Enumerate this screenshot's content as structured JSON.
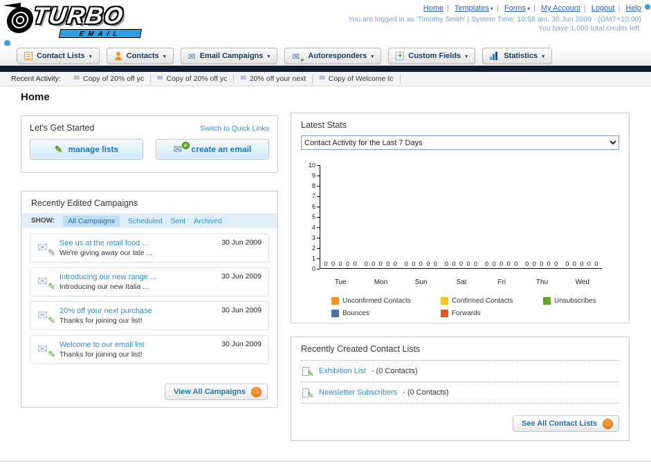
{
  "icons": {
    "caret": "▾",
    "envelope": "✉",
    "pencil": "✎",
    "arrow_right": "→",
    "play": "►",
    "plus": "+"
  },
  "header": {
    "logo_main": "TURBO",
    "logo_sub": "EMAIL",
    "links": [
      {
        "label": "Home"
      },
      {
        "label": "Templates"
      },
      {
        "label": "Forms"
      },
      {
        "label": "My Account"
      },
      {
        "label": "Logout"
      },
      {
        "label": "Help"
      }
    ],
    "login_line": "You are logged in as 'Timothy Smith' | System Time: 10:58 am, 30 Jun 2009 - (GMT+10:00)",
    "credits_line": "You have 1,000 total credits left."
  },
  "nav": {
    "tabs": [
      {
        "label": "Contact Lists"
      },
      {
        "label": "Contacts"
      },
      {
        "label": "Email Campaigns"
      },
      {
        "label": "Autoresponders"
      },
      {
        "label": "Custom Fields"
      },
      {
        "label": "Statistics"
      }
    ]
  },
  "recent_activity": {
    "label": "Recent Activity:",
    "items": [
      "Copy of 20% off yc",
      "Copy of 20% off yc",
      "20% off your next",
      "Copy of Welcome tc"
    ]
  },
  "page": {
    "title": "Home"
  },
  "get_started": {
    "title": "Let's Get Started",
    "switch_link": "Switch to Quick Links",
    "manage_lists": "manage lists",
    "create_email": "create an email"
  },
  "campaigns": {
    "title": "Recently Edited Campaigns",
    "show_label": "SHOW:",
    "filters": [
      "All Campaigns",
      "Scheduled",
      "Sent",
      "Archived"
    ],
    "active_filter": "All Campaigns",
    "items": [
      {
        "title": "See us at the retail food ...",
        "subtitle": "We're giving away our late ...",
        "date": "30 Jun 2009"
      },
      {
        "title": "Introducing our new range ...",
        "subtitle": "Introducing our new Italia ...",
        "date": "30 Jun 2009"
      },
      {
        "title": "20% off your next purchase",
        "subtitle": "Thanks for joining our list!",
        "date": "30 Jun 2009"
      },
      {
        "title": "Welcome to our email list",
        "subtitle": "Thanks for joining our list!",
        "date": "30 Jun 2009"
      }
    ],
    "view_all": "View All Campaigns"
  },
  "stats": {
    "title": "Latest Stats",
    "dropdown_value": "Contact Activity for the Last 7 Days"
  },
  "chart_data": {
    "type": "bar",
    "categories": [
      "Tue",
      "Mon",
      "Sun",
      "Sat",
      "Fri",
      "Thu",
      "Wed"
    ],
    "series": [
      {
        "name": "Unconfirmed Contacts",
        "color": "#f6921e",
        "values": [
          0,
          0,
          0,
          0,
          0,
          0,
          0
        ]
      },
      {
        "name": "Confirmed Contacts",
        "color": "#fdc51b",
        "values": [
          0,
          0,
          0,
          0,
          0,
          0,
          0
        ]
      },
      {
        "name": "Unsubscribes",
        "color": "#61a723",
        "values": [
          0,
          0,
          0,
          0,
          0,
          0,
          0
        ]
      },
      {
        "name": "Bounces",
        "color": "#4f6fa5",
        "values": [
          0,
          0,
          0,
          0,
          0,
          0,
          0
        ]
      },
      {
        "name": "Forwards",
        "color": "#e65425",
        "values": [
          0,
          0,
          0,
          0,
          0,
          0,
          0
        ]
      }
    ],
    "ylim": [
      0,
      10
    ],
    "grid": false,
    "legend_position": "bottom"
  },
  "contact_lists": {
    "title": "Recently Created Contact Lists",
    "items": [
      {
        "name": "Exhibition List",
        "suffix": "- (0 Contacts)"
      },
      {
        "name": "Newsletter Subscribers",
        "suffix": "- (0 Contacts)"
      }
    ],
    "see_all": "See All Contact Lists"
  }
}
